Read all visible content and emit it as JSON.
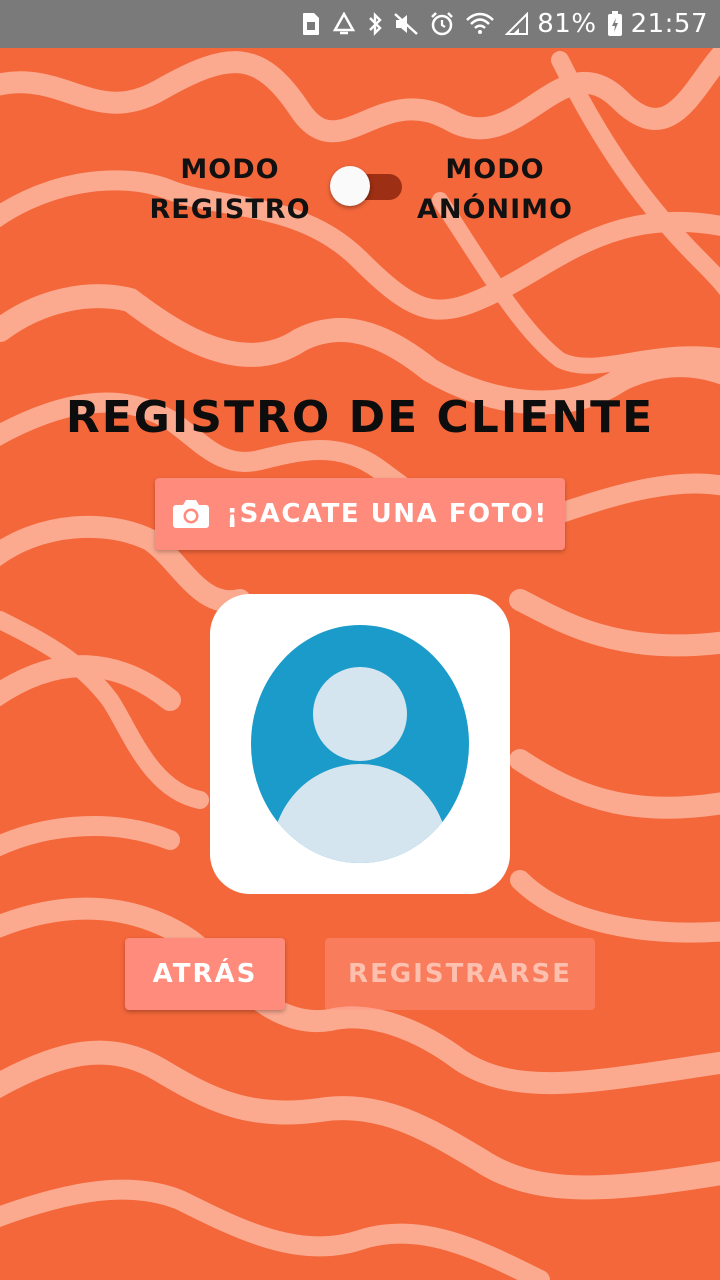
{
  "status_bar": {
    "battery_percent": "81%",
    "time": "21:57",
    "icons": [
      "sim-card-icon",
      "recycle-icon",
      "bluetooth-icon",
      "mute-icon",
      "alarm-icon",
      "wifi-icon",
      "signal-icon",
      "battery-charging-icon"
    ]
  },
  "mode_toggle": {
    "left_label": [
      "Modo",
      "Registro"
    ],
    "right_label": [
      "Modo",
      "Anónimo"
    ],
    "anonymous_enabled": true
  },
  "title": "Registro de Cliente",
  "photo_button": {
    "label": "¡Sacate una foto!",
    "icon": "camera-icon"
  },
  "avatar": {
    "icon": "user-avatar-icon"
  },
  "actions": {
    "back_label": "Atrás",
    "register_label": "Registrarse",
    "register_enabled": false
  },
  "colors": {
    "background": "#f4673a",
    "stripes": "#fbaa90",
    "button": "#ff8b7c",
    "avatar_circle": "#1a9bc9",
    "avatar_person": "#d5e5ef",
    "switch_track": "#9c2f14"
  }
}
